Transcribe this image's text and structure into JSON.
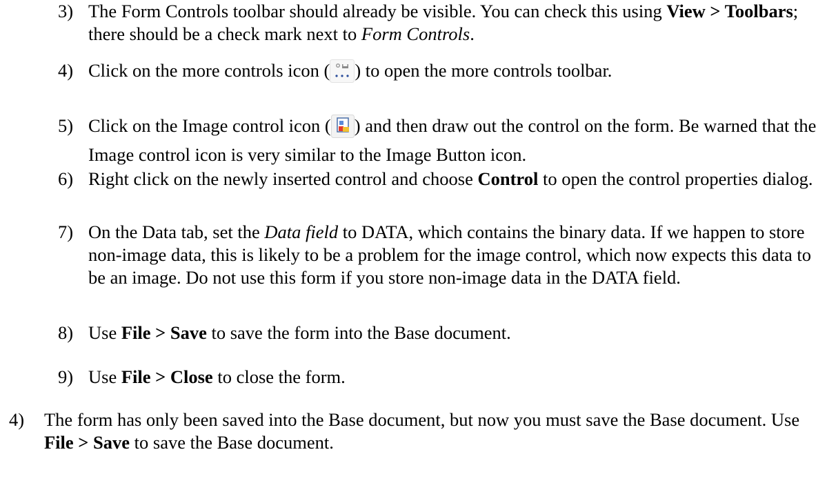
{
  "steps": [
    {
      "number": "3)",
      "parts": [
        "The Form Controls toolbar should already be visible. You can check this using ",
        "View > Toolbars",
        "; there should be a check mark next to ",
        "Form Controls",
        "."
      ]
    },
    {
      "number": "4)",
      "parts": [
        "Click on the more controls icon (",
        ") to open the more controls toolbar."
      ],
      "icon": "more-controls-icon"
    },
    {
      "number": "5)",
      "parts": [
        "Click on the Image control icon (",
        ") and then draw out the control on the form. Be warned that the Image control icon is very similar to the Image Button icon."
      ],
      "icon": "image-control-icon"
    },
    {
      "number": "6)",
      "parts": [
        "Right click on the newly inserted control and choose ",
        "Control",
        " to open the control properties dialog."
      ]
    },
    {
      "number": "7)",
      "parts": [
        "On the Data tab, set the ",
        "Data field",
        " to DATA, which contains the binary data. If we happen to store non-image data, this is likely to be a problem for the image control, which now expects this data to be an image. Do not use this form if you store non-image data in the DATA field."
      ]
    },
    {
      "number": "8)",
      "parts": [
        "Use ",
        "File > Save",
        " to save the form into the Base document."
      ]
    },
    {
      "number": "9)",
      "parts": [
        "Use ",
        "File > Close",
        " to close the form."
      ]
    },
    {
      "number": "4)",
      "parts": [
        "The form has only been saved into the Base document, but now you must save the Base document. Use ",
        "File > Save",
        " to save the Base document."
      ]
    }
  ]
}
